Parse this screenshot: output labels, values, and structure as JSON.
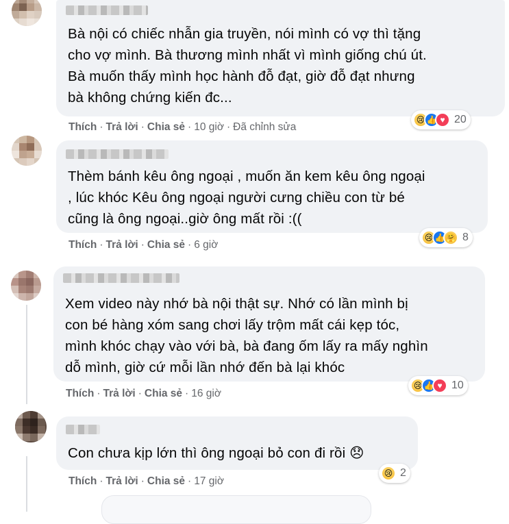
{
  "actions": {
    "like": "Thích",
    "reply": "Trả lời",
    "share": "Chia sẻ",
    "dot": "·"
  },
  "comments": [
    {
      "text": "Bà nội có chiếc nhẫn gia truyền, nói mình có vợ thì tặng\ncho vợ mình. Bà thương mình nhất vì mình giống chú út.\nBà muốn thấy mình học hành đỗ đạt, giờ đỗ đạt nhưng\nbà không chứng kiến đc...",
      "time": "10 giờ",
      "edited": "Đã chỉnh sửa",
      "reaction_icons": [
        "sad-reaction-icon",
        "like-reaction-icon",
        "love-reaction-icon"
      ],
      "reaction_count": "20"
    },
    {
      "text": "Thèm bánh kêu ông ngoại , muốn ăn kem kêu ông ngoại\n, lúc khóc Kêu ông ngoại người cưng chiều con từ bé\ncũng là ông ngoại..giờ ông mất rồi :((",
      "time": "6 giờ",
      "reaction_icons": [
        "sad-reaction-icon",
        "like-reaction-icon",
        "care-reaction-icon"
      ],
      "reaction_count": "8"
    },
    {
      "text": "Xem video này nhớ bà nội thật sự. Nhớ có lần mình bị\ncon bé hàng xóm sang chơi lấy trộm mất cái kẹp tóc,\nmình khóc chạy vào với bà, bà đang ốm lấy ra mấy nghìn\ndỗ mình, giờ cứ mỗi lần nhớ đến bà lại khóc",
      "time": "16 giờ",
      "reaction_icons": [
        "sad-reaction-icon",
        "like-reaction-icon",
        "love-reaction-icon"
      ],
      "reaction_count": "10"
    },
    {
      "text": "Con chưa kịp lớn thì ông ngoại bỏ con đi rồi",
      "emoji": "😞",
      "time": "17 giờ",
      "reaction_icons": [
        "sad-reaction-icon"
      ],
      "reaction_count": "2"
    }
  ]
}
